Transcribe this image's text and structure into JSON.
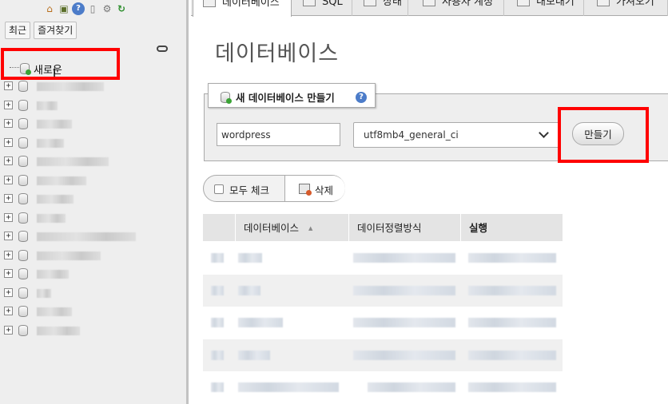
{
  "navigation": {
    "buttons": {
      "recent": "최근",
      "favorites": "즐겨찾기"
    },
    "tree_new_label": "새로운",
    "blurred_database_count": 14
  },
  "top_tabs": [
    {
      "label": "데이터베이스",
      "active": true
    },
    {
      "label": "SQL"
    },
    {
      "label": "상태"
    },
    {
      "label": "사용자 계정"
    },
    {
      "label": "내보내기"
    },
    {
      "label": "가져오기"
    }
  ],
  "main": {
    "title": "데이터베이스",
    "create_db": {
      "legend": "새 데이터베이스 만들기",
      "name_value": "wordpress",
      "collation_value": "utf8mb4_general_ci",
      "button_label": "만들기"
    },
    "bulk": {
      "check_all_label": "모두 체크",
      "delete_label": "삭제"
    },
    "table": {
      "headers": [
        "데이터베이스",
        "데이터정렬방식",
        "실행"
      ],
      "blurred_row_count": 5
    }
  },
  "colors": {
    "highlight": "#ff0000",
    "nav_background": "#eeeeee"
  }
}
